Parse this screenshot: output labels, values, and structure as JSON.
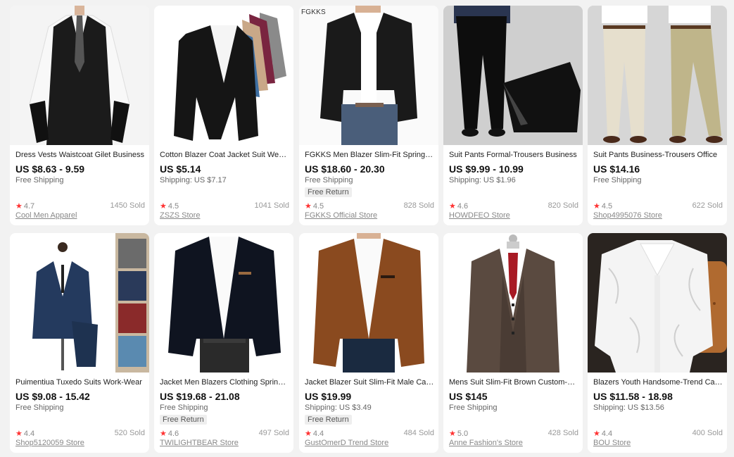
{
  "colors": {
    "star": "#ff3333",
    "price": "#111111",
    "muted": "#888888",
    "background": "#f2f2f2"
  },
  "icons": {
    "rating": "star-icon"
  },
  "products": [
    {
      "image": "black-vest-photo",
      "brand_tag": "",
      "title": "Dress Vests Waistcoat Gilet Business",
      "price": "US $8.63 - 9.59",
      "shipping": "Free Shipping",
      "badge": "",
      "rating": "4.7",
      "sold": "1450 Sold",
      "store": "Cool Men Apparel"
    },
    {
      "image": "cotton-blazers-photo",
      "brand_tag": "",
      "title": "Cotton Blazer Coat Jacket Suit Wedding",
      "price": "US $5.14",
      "shipping": "Shipping: US $7.17",
      "badge": "",
      "rating": "4.5",
      "sold": "1041 Sold",
      "store": "ZSZS Store"
    },
    {
      "image": "black-blazer-jeans-photo",
      "brand_tag": "FGKKS",
      "title": "FGKKS Men Blazer Slim-Fit Spring-Autumn",
      "price": "US $18.60 - 20.30",
      "shipping": "Free Shipping",
      "badge": "Free Return",
      "rating": "4.5",
      "sold": "828 Sold",
      "store": "FGKKS Official Store"
    },
    {
      "image": "black-trousers-photo",
      "brand_tag": "",
      "title": "Suit Pants Formal-Trousers Business",
      "price": "US $9.99 - 10.99",
      "shipping": "Shipping: US $1.96",
      "badge": "",
      "rating": "4.6",
      "sold": "820 Sold",
      "store": "HOWDFEO Store"
    },
    {
      "image": "khaki-trousers-photo",
      "brand_tag": "",
      "title": "Suit Pants Business-Trousers Office",
      "price": "US $14.16",
      "shipping": "Free Shipping",
      "badge": "",
      "rating": "4.5",
      "sold": "622 Sold",
      "store": "Shop4995076 Store"
    },
    {
      "image": "navy-tuxedo-mannequin-photo",
      "brand_tag": "",
      "title": "Puimentiua Tuxedo Suits Work-Wear",
      "price": "US $9.08 - 15.42",
      "shipping": "Free Shipping",
      "badge": "",
      "rating": "4.4",
      "sold": "520 Sold",
      "store": "Shop5120059 Store"
    },
    {
      "image": "velvet-blazer-photo",
      "brand_tag": "",
      "title": "Jacket Men Blazers Clothing Spring-Autumn",
      "price": "US $19.68 - 21.08",
      "shipping": "Free Shipping",
      "badge": "Free Return",
      "rating": "4.6",
      "sold": "497 Sold",
      "store": "TWILIGHTBEAR Store"
    },
    {
      "image": "brown-blazer-photo",
      "brand_tag": "",
      "title": "Jacket Blazer Suit Slim-Fit Male Casual",
      "price": "US $19.99",
      "shipping": "Shipping: US $3.49",
      "badge": "Free Return",
      "rating": "4.4",
      "sold": "484 Sold",
      "store": "GustOmerD Trend Store"
    },
    {
      "image": "brown-three-piece-suit-photo",
      "brand_tag": "",
      "title": "Mens Suit Slim-Fit Brown Custom-Made",
      "price": "US $145",
      "shipping": "Free Shipping",
      "badge": "",
      "rating": "5.0",
      "sold": "428 Sold",
      "store": "Anne Fashion's Store"
    },
    {
      "image": "white-pattern-blazer-photo",
      "brand_tag": "",
      "title": "Blazers Youth Handsome-Trend Casual",
      "price": "US $11.58 - 18.98",
      "shipping": "Shipping: US $13.56",
      "badge": "",
      "rating": "4.4",
      "sold": "400 Sold",
      "store": "BOU Store"
    }
  ]
}
